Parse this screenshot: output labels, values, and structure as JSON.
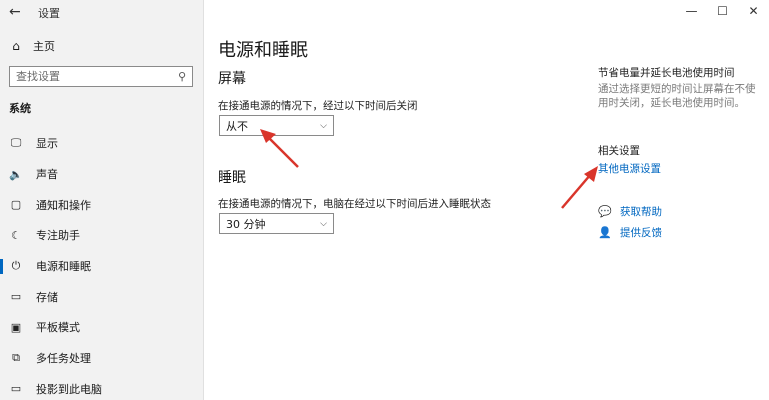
{
  "window": {
    "title": "设置",
    "back_icon": "back-arrow-icon",
    "minimize": "—",
    "maximize": "☐",
    "close": "✕"
  },
  "sidebar": {
    "home_label": "主页",
    "search_placeholder": "查找设置",
    "section_label": "系统",
    "items": [
      {
        "label": "显示",
        "icon": "monitor-icon",
        "glyph": "🖵"
      },
      {
        "label": "声音",
        "icon": "speaker-icon",
        "glyph": "🔈"
      },
      {
        "label": "通知和操作",
        "icon": "notification-icon",
        "glyph": "▢"
      },
      {
        "label": "专注助手",
        "icon": "moon-icon",
        "glyph": "☾"
      },
      {
        "label": "电源和睡眠",
        "icon": "power-icon",
        "glyph": "⏻",
        "active": true
      },
      {
        "label": "存储",
        "icon": "storage-icon",
        "glyph": "▭"
      },
      {
        "label": "平板模式",
        "icon": "tablet-icon",
        "glyph": "▣"
      },
      {
        "label": "多任务处理",
        "icon": "multitask-icon",
        "glyph": "⧉"
      },
      {
        "label": "投影到此电脑",
        "icon": "project-icon",
        "glyph": "▭"
      }
    ]
  },
  "main": {
    "title": "电源和睡眠",
    "screen": {
      "heading": "屏幕",
      "description": "在接通电源的情况下，经过以下时间后关闭",
      "value": "从不"
    },
    "sleep": {
      "heading": "睡眠",
      "description": "在接通电源的情况下，电脑在经过以下时间后进入睡眠状态",
      "value": "30 分钟"
    }
  },
  "right_panel": {
    "tip_title": "节省电量并延长电池使用时间",
    "tip_desc": "通过选择更短的时间让屏幕在不使用时关闭，延长电池使用时间。",
    "related_title": "相关设置",
    "related_link": "其他电源设置",
    "help_label": "获取帮助",
    "feedback_label": "提供反馈"
  },
  "colors": {
    "accent": "#0067c0",
    "annotation_arrow": "#d9352b"
  }
}
